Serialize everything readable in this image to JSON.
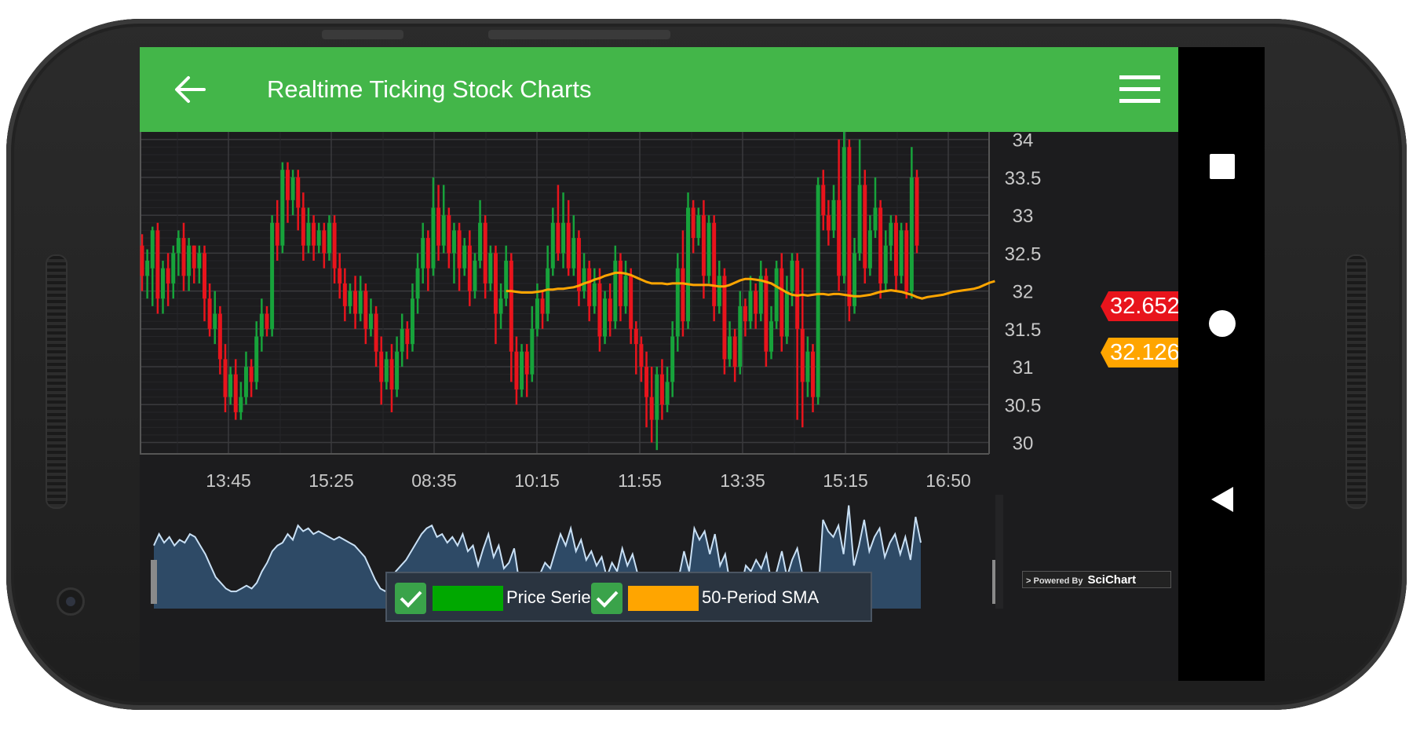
{
  "app": {
    "title": "Realtime Ticking Stock Charts"
  },
  "colors": {
    "appbar": "#43b649",
    "up_candle": "#17a33b",
    "down_candle": "#e8141c",
    "sma": "#ffa500",
    "last_price_badge": "#e8141c",
    "sma_badge": "#ffa500",
    "overview_fill": "#2e4a66",
    "overview_line": "#c9e0f5"
  },
  "icons": {
    "back": "arrow-left-icon",
    "menu": "hamburger-menu-icon",
    "nav_recent": "square-icon",
    "nav_home": "circle-icon",
    "nav_back": "triangle-left-icon"
  },
  "legend": {
    "items": [
      {
        "label": "Price Series",
        "checked": true,
        "swatch": "#00a800"
      },
      {
        "label": "50-Period SMA",
        "checked": true,
        "swatch": "#ffa500"
      }
    ]
  },
  "badges": {
    "last_price": "32.652",
    "sma_value": "32.126"
  },
  "watermark": {
    "prefix": "> Powered By",
    "brand": "SciChart"
  },
  "chart_data": {
    "type": "candlestick",
    "x_tick_labels": [
      "13:45",
      "15:25",
      "08:35",
      "10:15",
      "11:55",
      "13:35",
      "15:15",
      "16:50"
    ],
    "y_tick_labels": [
      "34",
      "33.5",
      "33",
      "32.5",
      "32",
      "31.5",
      "31",
      "30.5",
      "30"
    ],
    "ylim": [
      29.85,
      34.1
    ],
    "grid": true,
    "legend_position": "bottom-center",
    "candles": [
      [
        32.6,
        32.2,
        32.75,
        32.0
      ],
      [
        32.2,
        32.4,
        32.55,
        31.9
      ],
      [
        32.3,
        32.8,
        32.85,
        31.8
      ],
      [
        32.8,
        31.9,
        32.9,
        31.7
      ],
      [
        31.9,
        32.3,
        32.4,
        31.7
      ],
      [
        32.3,
        32.1,
        32.5,
        31.8
      ],
      [
        32.1,
        32.5,
        32.6,
        31.9
      ],
      [
        32.5,
        32.7,
        32.8,
        32.2
      ],
      [
        32.7,
        32.2,
        32.9,
        32.0
      ],
      [
        32.2,
        32.6,
        32.7,
        32.0
      ],
      [
        32.6,
        32.3,
        32.6,
        32.1
      ],
      [
        32.3,
        32.5,
        32.6,
        32.1
      ],
      [
        32.5,
        31.9,
        32.6,
        31.6
      ],
      [
        31.9,
        31.5,
        32.1,
        31.4
      ],
      [
        31.5,
        31.7,
        32.0,
        31.3
      ],
      [
        31.7,
        31.1,
        31.8,
        30.9
      ],
      [
        31.1,
        30.6,
        31.3,
        30.4
      ],
      [
        30.6,
        30.9,
        31.0,
        30.5
      ],
      [
        30.9,
        30.4,
        31.1,
        30.3
      ],
      [
        30.4,
        30.6,
        30.8,
        30.3
      ],
      [
        30.6,
        31.0,
        31.2,
        30.5
      ],
      [
        31.0,
        30.8,
        31.1,
        30.6
      ],
      [
        30.8,
        31.4,
        31.6,
        30.7
      ],
      [
        31.4,
        31.7,
        31.9,
        31.2
      ],
      [
        31.7,
        31.5,
        31.8,
        31.4
      ],
      [
        31.5,
        32.9,
        33.0,
        31.4
      ],
      [
        32.9,
        32.6,
        33.2,
        32.4
      ],
      [
        32.6,
        33.6,
        33.7,
        32.5
      ],
      [
        33.6,
        33.2,
        33.7,
        32.9
      ],
      [
        33.2,
        33.5,
        33.6,
        33.0
      ],
      [
        33.5,
        33.1,
        33.6,
        32.8
      ],
      [
        33.1,
        32.6,
        33.3,
        32.4
      ],
      [
        32.6,
        32.9,
        33.1,
        32.5
      ],
      [
        32.9,
        32.6,
        33.0,
        32.4
      ],
      [
        32.6,
        32.8,
        32.9,
        32.5
      ],
      [
        32.8,
        32.5,
        32.9,
        32.3
      ],
      [
        32.5,
        32.9,
        33.0,
        32.4
      ],
      [
        32.9,
        32.3,
        33.0,
        32.1
      ],
      [
        32.3,
        32.1,
        32.5,
        31.9
      ],
      [
        32.1,
        31.8,
        32.3,
        31.6
      ],
      [
        31.8,
        32.0,
        32.1,
        31.7
      ],
      [
        32.0,
        31.7,
        32.2,
        31.5
      ],
      [
        31.7,
        32.0,
        32.2,
        31.6
      ],
      [
        32.0,
        31.5,
        32.1,
        31.3
      ],
      [
        31.5,
        31.7,
        31.9,
        31.4
      ],
      [
        31.7,
        31.2,
        31.8,
        31.0
      ],
      [
        31.2,
        30.8,
        31.4,
        30.5
      ],
      [
        30.8,
        31.1,
        31.2,
        30.7
      ],
      [
        31.1,
        30.7,
        31.3,
        30.4
      ],
      [
        30.7,
        31.2,
        31.4,
        30.6
      ],
      [
        31.2,
        31.5,
        31.7,
        31.0
      ],
      [
        31.5,
        31.3,
        31.6,
        31.1
      ],
      [
        31.3,
        31.9,
        32.1,
        31.2
      ],
      [
        31.9,
        32.3,
        32.5,
        31.7
      ],
      [
        32.3,
        32.7,
        32.9,
        32.1
      ],
      [
        32.7,
        32.3,
        32.8,
        32.0
      ],
      [
        32.3,
        33.1,
        33.5,
        32.2
      ],
      [
        33.1,
        32.6,
        33.4,
        32.4
      ],
      [
        32.6,
        33.0,
        33.4,
        32.5
      ],
      [
        33.0,
        32.5,
        33.1,
        32.3
      ],
      [
        32.5,
        32.8,
        32.9,
        32.1
      ],
      [
        32.8,
        32.3,
        32.9,
        32.0
      ],
      [
        32.3,
        32.6,
        32.7,
        32.2
      ],
      [
        32.6,
        32.0,
        32.8,
        31.8
      ],
      [
        32.0,
        32.4,
        32.5,
        31.9
      ],
      [
        32.4,
        32.9,
        33.2,
        32.3
      ],
      [
        32.9,
        32.1,
        33.0,
        31.9
      ],
      [
        32.1,
        32.5,
        32.6,
        32.0
      ],
      [
        32.5,
        31.7,
        32.6,
        31.3
      ],
      [
        31.7,
        31.9,
        32.1,
        31.5
      ],
      [
        31.9,
        32.4,
        32.6,
        31.8
      ],
      [
        32.4,
        31.2,
        32.5,
        30.8
      ],
      [
        31.2,
        30.7,
        31.4,
        30.5
      ],
      [
        30.7,
        31.2,
        31.3,
        30.6
      ],
      [
        31.2,
        30.9,
        31.3,
        30.6
      ],
      [
        30.9,
        31.5,
        31.8,
        30.8
      ],
      [
        31.5,
        31.9,
        32.1,
        31.4
      ],
      [
        31.9,
        31.7,
        32.0,
        31.5
      ],
      [
        31.7,
        32.3,
        32.6,
        31.6
      ],
      [
        32.3,
        32.9,
        33.1,
        32.2
      ],
      [
        32.9,
        32.5,
        33.4,
        32.4
      ],
      [
        32.5,
        32.9,
        33.3,
        32.3
      ],
      [
        32.9,
        32.3,
        33.2,
        32.2
      ],
      [
        32.3,
        32.7,
        33.0,
        32.2
      ],
      [
        32.7,
        32.0,
        32.8,
        31.8
      ],
      [
        32.0,
        32.3,
        32.5,
        31.9
      ],
      [
        32.3,
        31.8,
        32.4,
        31.6
      ],
      [
        31.8,
        32.1,
        32.3,
        31.7
      ],
      [
        32.1,
        31.4,
        32.3,
        31.2
      ],
      [
        31.4,
        31.9,
        32.0,
        31.3
      ],
      [
        31.9,
        31.6,
        32.1,
        31.4
      ],
      [
        31.6,
        32.4,
        32.6,
        31.5
      ],
      [
        32.4,
        31.8,
        32.5,
        31.6
      ],
      [
        31.8,
        32.2,
        32.4,
        31.7
      ],
      [
        32.2,
        31.5,
        32.3,
        31.3
      ],
      [
        31.5,
        31.3,
        31.6,
        30.9
      ],
      [
        31.3,
        31.0,
        31.4,
        30.8
      ],
      [
        31.0,
        30.6,
        31.2,
        30.2
      ],
      [
        30.6,
        30.3,
        31.0,
        30.0
      ],
      [
        30.3,
        30.9,
        31.0,
        29.9
      ],
      [
        30.9,
        30.5,
        31.1,
        30.3
      ],
      [
        30.5,
        30.8,
        31.0,
        30.4
      ],
      [
        30.8,
        31.4,
        31.6,
        30.6
      ],
      [
        31.4,
        32.3,
        32.5,
        31.2
      ],
      [
        32.3,
        31.6,
        32.8,
        31.4
      ],
      [
        31.6,
        33.1,
        33.3,
        31.5
      ],
      [
        33.1,
        32.7,
        33.2,
        32.5
      ],
      [
        32.7,
        33.0,
        33.1,
        32.6
      ],
      [
        33.0,
        32.2,
        33.2,
        31.9
      ],
      [
        32.2,
        32.9,
        33.0,
        32.1
      ],
      [
        32.9,
        31.8,
        33.0,
        31.6
      ],
      [
        31.8,
        32.2,
        32.4,
        31.7
      ],
      [
        32.2,
        31.1,
        32.3,
        30.9
      ],
      [
        31.1,
        31.4,
        31.6,
        31.0
      ],
      [
        31.4,
        31.0,
        31.5,
        30.8
      ],
      [
        31.0,
        31.8,
        32.0,
        30.9
      ],
      [
        31.8,
        31.6,
        31.9,
        31.4
      ],
      [
        31.6,
        32.0,
        32.2,
        31.5
      ],
      [
        32.0,
        31.7,
        32.1,
        31.5
      ],
      [
        31.7,
        32.2,
        32.4,
        31.6
      ],
      [
        32.2,
        31.2,
        32.3,
        31.0
      ],
      [
        31.2,
        31.6,
        31.8,
        31.1
      ],
      [
        31.6,
        32.3,
        32.4,
        31.5
      ],
      [
        32.3,
        31.4,
        32.5,
        31.2
      ],
      [
        31.4,
        32.0,
        32.2,
        31.3
      ],
      [
        32.0,
        32.4,
        32.5,
        31.8
      ],
      [
        32.4,
        31.5,
        32.5,
        30.3
      ],
      [
        31.5,
        30.8,
        32.3,
        30.2
      ],
      [
        30.8,
        31.2,
        31.4,
        30.6
      ],
      [
        31.2,
        30.6,
        31.3,
        30.4
      ],
      [
        30.6,
        33.4,
        33.5,
        30.5
      ],
      [
        33.4,
        33.0,
        33.6,
        32.8
      ],
      [
        33.0,
        32.8,
        33.2,
        32.6
      ],
      [
        32.8,
        33.2,
        33.4,
        32.7
      ],
      [
        33.2,
        32.2,
        34.0,
        32.0
      ],
      [
        32.2,
        33.9,
        34.1,
        32.1
      ],
      [
        33.9,
        31.8,
        34.0,
        31.6
      ],
      [
        31.8,
        32.5,
        32.7,
        31.7
      ],
      [
        32.5,
        33.4,
        34.0,
        32.4
      ],
      [
        33.4,
        32.3,
        33.6,
        32.1
      ],
      [
        32.3,
        32.8,
        33.0,
        32.2
      ],
      [
        32.8,
        33.1,
        33.5,
        32.7
      ],
      [
        33.1,
        32.1,
        33.2,
        31.9
      ],
      [
        32.1,
        32.6,
        32.8,
        32.0
      ],
      [
        32.6,
        32.9,
        33.0,
        32.4
      ],
      [
        32.9,
        32.2,
        33.0,
        32.0
      ],
      [
        32.2,
        32.8,
        32.9,
        32.1
      ],
      [
        32.8,
        32.0,
        32.9,
        31.9
      ],
      [
        32.0,
        33.5,
        33.9,
        31.9
      ],
      [
        33.5,
        32.6,
        33.6,
        32.5
      ]
    ],
    "sma_start_index": 70,
    "sma_values": [
      32.0,
      32.0,
      31.99,
      31.98,
      31.98,
      31.98,
      31.99,
      32.0,
      32.02,
      32.02,
      32.03,
      32.03,
      32.04,
      32.05,
      32.07,
      32.1,
      32.12,
      32.15,
      32.17,
      32.2,
      32.22,
      32.24,
      32.24,
      32.23,
      32.21,
      32.18,
      32.15,
      32.12,
      32.1,
      32.1,
      32.1,
      32.09,
      32.1,
      32.1,
      32.1,
      32.09,
      32.08,
      32.08,
      32.08,
      32.08,
      32.07,
      32.06,
      32.06,
      32.08,
      32.11,
      32.14,
      32.16,
      32.16,
      32.15,
      32.14,
      32.12,
      32.1,
      32.06,
      32.02,
      31.98,
      31.95,
      31.94,
      31.95,
      31.94,
      31.95,
      31.96,
      31.96,
      31.95,
      31.96,
      31.96,
      31.95,
      31.94,
      31.93,
      31.93,
      31.94,
      31.95,
      31.97,
      31.99,
      32.0,
      32.01,
      32.0,
      31.99,
      31.97,
      31.95,
      31.92,
      31.9,
      31.92,
      31.93,
      31.94,
      31.95,
      31.97,
      31.99,
      32.0,
      32.01,
      32.02,
      32.03,
      32.05,
      32.08,
      32.11,
      32.13
    ],
    "overview": {
      "type": "area",
      "values": [
        32.5,
        32.9,
        32.6,
        32.8,
        32.5,
        32.7,
        32.6,
        32.9,
        32.8,
        32.5,
        32.2,
        31.8,
        31.4,
        31.2,
        31.0,
        30.9,
        30.9,
        31.0,
        31.1,
        31.0,
        31.2,
        31.6,
        31.9,
        32.3,
        32.5,
        32.6,
        32.9,
        32.7,
        33.2,
        33.0,
        33.1,
        32.9,
        33.0,
        32.9,
        32.8,
        32.7,
        32.8,
        32.7,
        32.6,
        32.5,
        32.3,
        32.1,
        31.7,
        31.3,
        31.0,
        30.9,
        31.3,
        31.6,
        31.8,
        32.0,
        32.3,
        32.6,
        32.9,
        33.1,
        33.2,
        32.8,
        32.9,
        32.6,
        32.8,
        32.5,
        32.9,
        32.3,
        32.5,
        31.8,
        32.4,
        32.9,
        32.1,
        32.5,
        31.7,
        31.9,
        32.4,
        31.2,
        30.7,
        31.2,
        30.9,
        31.5,
        31.9,
        31.7,
        32.3,
        32.9,
        32.5,
        33.1,
        32.3,
        32.7,
        32.0,
        32.3,
        31.8,
        32.1,
        31.4,
        31.9,
        31.6,
        32.4,
        31.8,
        32.2,
        31.5,
        31.3,
        31.0,
        30.6,
        30.3,
        30.9,
        30.5,
        30.8,
        31.4,
        32.3,
        31.6,
        33.1,
        32.7,
        33.0,
        32.2,
        32.9,
        31.8,
        32.2,
        31.1,
        31.4,
        31.0,
        31.8,
        31.6,
        32.0,
        31.7,
        32.2,
        31.2,
        31.6,
        32.3,
        31.4,
        32.0,
        32.4,
        31.5,
        30.8,
        31.2,
        30.6,
        33.4,
        33.0,
        32.8,
        33.2,
        32.2,
        33.9,
        31.8,
        32.5,
        33.4,
        32.3,
        32.8,
        33.1,
        32.1,
        32.6,
        32.9,
        32.2,
        32.8,
        32.0,
        33.5,
        32.6
      ],
      "ylim": [
        30.3,
        34.0
      ]
    }
  }
}
